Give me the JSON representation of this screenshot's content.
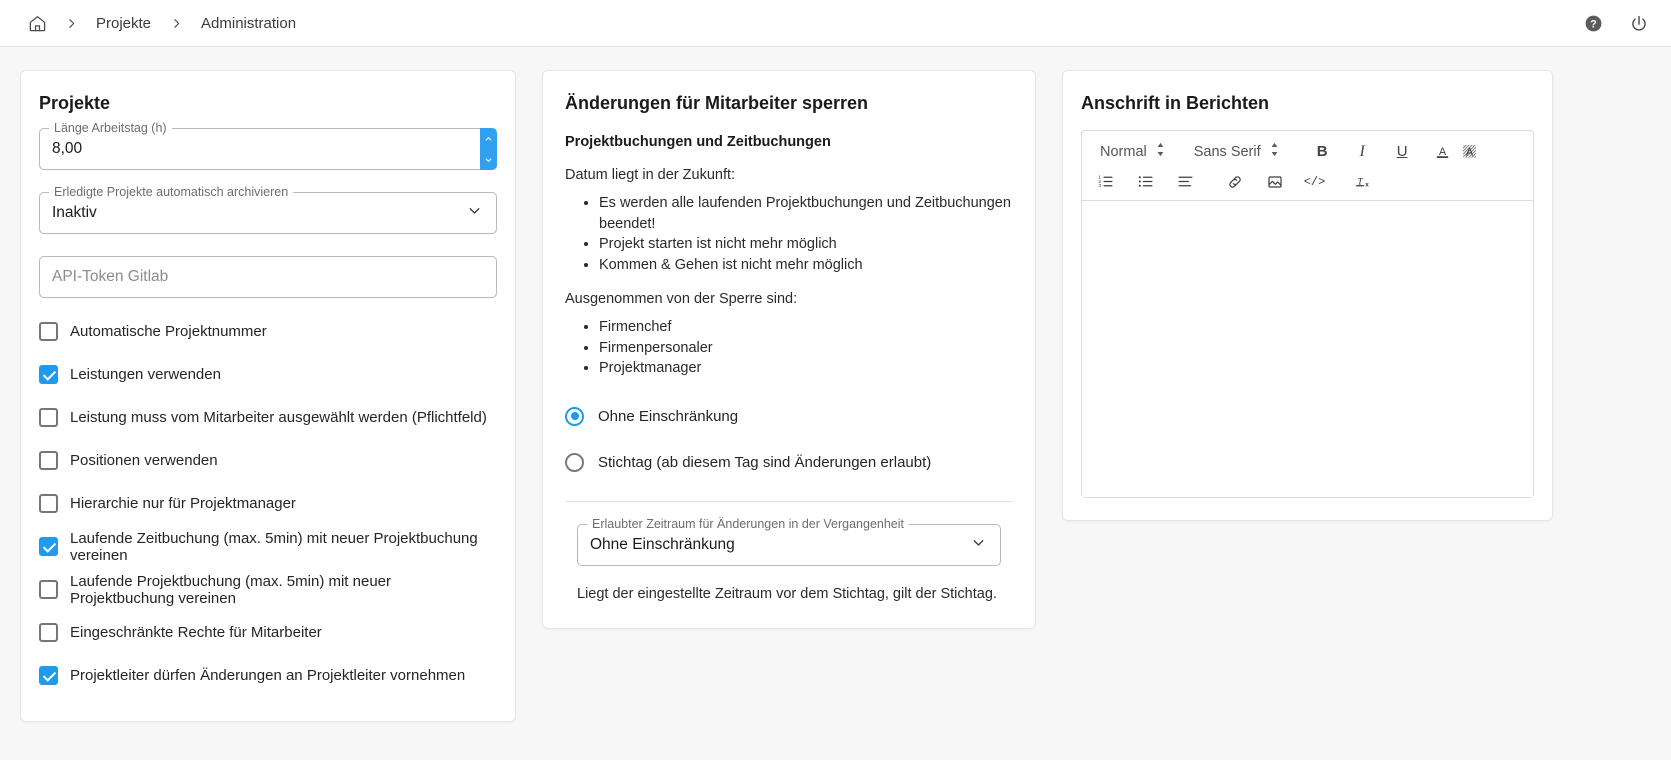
{
  "topbar": {
    "home_icon": "home-icon",
    "separator": "›",
    "crumb1": "Projekte",
    "crumb2": "Administration",
    "help_icon": "help-circle-icon",
    "power_icon": "power-icon"
  },
  "projects": {
    "title": "Projekte",
    "workday": {
      "label": "Länge Arbeitstag (h)",
      "value": "8,00"
    },
    "archive": {
      "label": "Erledigte Projekte automatisch archivieren",
      "value": "Inaktiv"
    },
    "api_token": {
      "placeholder": "API-Token Gitlab",
      "value": ""
    },
    "checkboxes": [
      {
        "label": "Automatische Projektnummer",
        "checked": false
      },
      {
        "label": "Leistungen verwenden",
        "checked": true
      },
      {
        "label": "Leistung muss vom Mitarbeiter ausgewählt werden (Pflichtfeld)",
        "checked": false
      },
      {
        "label": "Positionen verwenden",
        "checked": false
      },
      {
        "label": "Hierarchie nur für Projektmanager",
        "checked": false
      },
      {
        "label": "Laufende Zeitbuchung (max. 5min) mit neuer Projektbuchung vereinen",
        "checked": true
      },
      {
        "label": "Laufende Projektbuchung (max. 5min) mit neuer Projektbuchung vereinen",
        "checked": false
      },
      {
        "label": "Eingeschränkte Rechte für Mitarbeiter",
        "checked": false
      },
      {
        "label": "Projektleiter dürfen Änderungen an Projektleiter vornehmen",
        "checked": true
      }
    ]
  },
  "lock": {
    "title": "Änderungen für Mitarbeiter sperren",
    "subhead": "Projektbuchungen und Zeitbuchungen",
    "future_intro": "Datum liegt in der Zukunft:",
    "future_items": [
      "Es werden alle laufenden Projektbuchungen und Zeitbuchungen beendet!",
      "Projekt starten ist nicht mehr möglich",
      "Kommen & Gehen ist nicht mehr möglich"
    ],
    "exempt_intro": "Ausgenommen von der Sperre sind:",
    "exempt_items": [
      "Firmenchef",
      "Firmenpersonaler",
      "Projektmanager"
    ],
    "radio1": {
      "label": "Ohne Einschränkung",
      "selected": true
    },
    "radio2": {
      "label": "Stichtag (ab diesem Tag sind Änderungen erlaubt)",
      "selected": false
    },
    "period": {
      "label": "Erlaubter Zeitraum für Änderungen in der Vergangenheit",
      "value": "Ohne Einschränkung"
    },
    "note": "Liegt der eingestellte Zeitraum vor dem Stichtag, gilt der Stichtag."
  },
  "address": {
    "title": "Anschrift in Berichten",
    "toolbar": {
      "block_format": "Normal",
      "font_family": "Sans Serif",
      "bold": "B",
      "italic": "I",
      "underline": "U",
      "text_color": "A",
      "highlight": "A",
      "ordered_list": "ordered-list-icon",
      "bullet_list": "bullet-list-icon",
      "align": "align-icon",
      "link": "link-icon",
      "image": "image-icon",
      "code": "code-icon",
      "clear_format": "clear-format-icon"
    },
    "content": ""
  },
  "colors": {
    "accent": "#1e9bf0",
    "spinner": "#31a0f0",
    "page_bg": "#f7f7f7",
    "card_border": "#e6e6e6"
  }
}
